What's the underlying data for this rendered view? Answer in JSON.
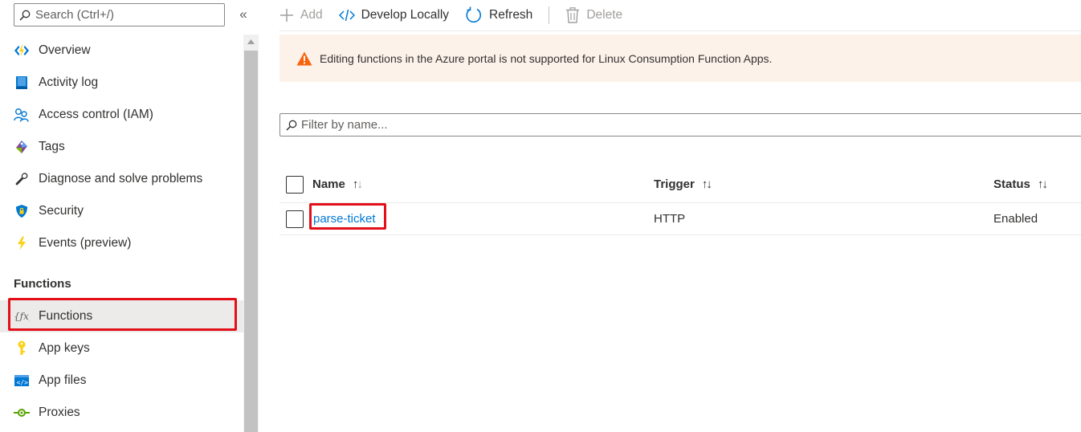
{
  "sidebar": {
    "search_placeholder": "Search (Ctrl+/)",
    "collapse_glyph": "«",
    "items": [
      {
        "label": "Overview",
        "icon": "lightning-bolt-icon"
      },
      {
        "label": "Activity log",
        "icon": "log-book-icon"
      },
      {
        "label": "Access control (IAM)",
        "icon": "people-icon"
      },
      {
        "label": "Tags",
        "icon": "tag-icon"
      },
      {
        "label": "Diagnose and solve problems",
        "icon": "wrench-icon"
      },
      {
        "label": "Security",
        "icon": "shield-icon"
      },
      {
        "label": "Events (preview)",
        "icon": "flash-icon"
      }
    ],
    "section_title": "Functions",
    "section_items": [
      {
        "label": "Functions",
        "icon": "function-icon",
        "active": true
      },
      {
        "label": "App keys",
        "icon": "key-icon"
      },
      {
        "label": "App files",
        "icon": "code-file-icon"
      },
      {
        "label": "Proxies",
        "icon": "proxy-icon"
      }
    ]
  },
  "toolbar": {
    "add": "Add",
    "develop": "Develop Locally",
    "refresh": "Refresh",
    "delete": "Delete"
  },
  "warning": {
    "text": "Editing functions in the Azure portal is not supported for Linux Consumption Function Apps."
  },
  "filter": {
    "placeholder": "Filter by name..."
  },
  "table": {
    "columns": [
      "Name",
      "Trigger",
      "Status"
    ],
    "rows": [
      {
        "name": "parse-ticket",
        "trigger": "HTTP",
        "status": "Enabled"
      }
    ]
  },
  "colors": {
    "accent": "#0078d4",
    "highlight": "#e3101a",
    "warning_bg": "#fdf2e9",
    "warning_icon": "#f7630c"
  }
}
